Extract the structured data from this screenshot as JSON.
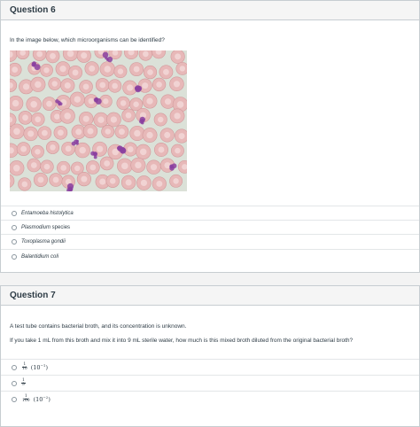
{
  "q6": {
    "title": "Question 6",
    "prompt": "In the image below, which microorganisms can be identified?",
    "answers": [
      {
        "prefix": "",
        "italic": "Entamoeba histolytica",
        "suffix": ""
      },
      {
        "prefix": "",
        "italic": "Plasmodium",
        "suffix": " species"
      },
      {
        "prefix": "",
        "italic": "Toxoplasma gondii",
        "suffix": ""
      },
      {
        "prefix": "",
        "italic": "Balantidium coli",
        "suffix": ""
      }
    ]
  },
  "q7": {
    "title": "Question 7",
    "prompt1": "A test tube contains bacterial broth, and its concentration is unknown.",
    "prompt2": "If you take 1 mL from this broth and mix it into 9 mL sterile water, how much is this mixed broth diluted from the original bacterial broth?",
    "answers": [
      {
        "num": "1",
        "den": "10",
        "paren": "(10",
        "exp": "−1",
        "close": ")"
      },
      {
        "num": "1",
        "den": "9",
        "paren": "",
        "exp": "",
        "close": ""
      },
      {
        "num": "1",
        "den": "100",
        "paren": "(10",
        "exp": "−2",
        "close": ")"
      }
    ]
  },
  "colors": {
    "header_bg": "#f5f5f5",
    "border": "#c7cdd1",
    "text": "#2d3b45",
    "stain_purple": "#8a3fa0"
  },
  "icons": {
    "radio": "radio-unchecked-icon"
  }
}
